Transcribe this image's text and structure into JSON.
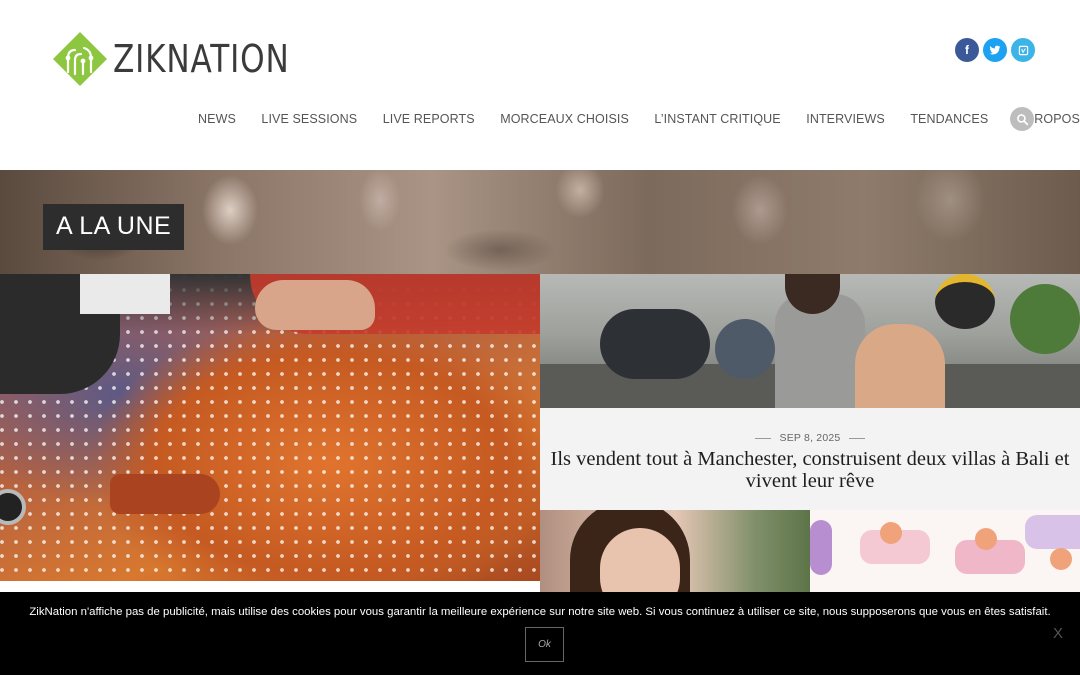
{
  "site": {
    "logo_text": "ZIKNATION",
    "brand_color": "#8dc63f"
  },
  "social": {
    "facebook": "f",
    "twitter": "t",
    "vimeo": "v"
  },
  "nav": {
    "items": [
      {
        "label": "NEWS"
      },
      {
        "label": "LIVE SESSIONS"
      },
      {
        "label": "LIVE REPORTS"
      },
      {
        "label": "MORCEAUX CHOISIS"
      },
      {
        "label": "L’INSTANT CRITIQUE"
      },
      {
        "label": "INTERVIEWS"
      },
      {
        "label": "TENDANCES"
      },
      {
        "label": "À PROPOS"
      }
    ],
    "search_icon": "search-icon"
  },
  "banner": {
    "label": "A LA UNE"
  },
  "featured": {
    "card": {
      "date": "SEP 8, 2025",
      "title": "Ils vendent tout à Manchester, construisent deux villas à Bali et vivent leur rêve"
    }
  },
  "cookie": {
    "text": "ZikNation n'affiche pas de publicité, mais utilise des cookies pour vous garantir la meilleure expérience sur notre site web. Si vous continuez à utiliser ce site, nous supposerons que vous en êtes satisfait.",
    "ok_label": "Ok",
    "close_label": "X"
  }
}
